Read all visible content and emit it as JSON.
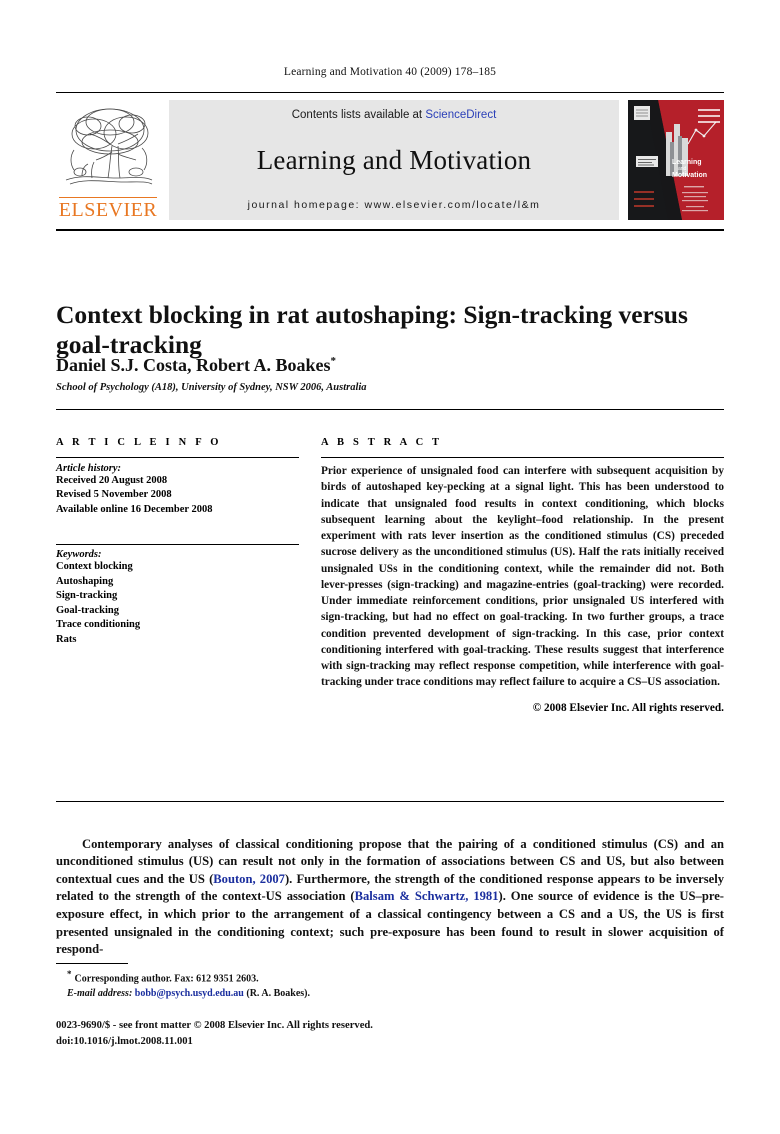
{
  "running_head": "Learning and Motivation 40 (2009) 178–185",
  "masthead": {
    "publisher_word": "ELSEVIER",
    "publisher_logo_name": "elsevier-tree-logo",
    "contents_prefix": "Contents lists available at ",
    "contents_link": "ScienceDirect",
    "journal_name": "Learning and Motivation",
    "homepage": "journal homepage: www.elsevier.com/locate/l&m",
    "cover_title_line1": "Learning",
    "cover_title_line2": "and",
    "cover_title_line3": "Motivation",
    "link_color": "#2b40b8",
    "elsevier_orange": "#E87722",
    "band_background": "#e6e6e6"
  },
  "article": {
    "title": "Context blocking in rat autoshaping: Sign-tracking versus goal-tracking",
    "authors": "Daniel S.J. Costa, Robert A. Boakes",
    "corresponding_marker": "*",
    "affiliation": "School of Psychology (A18), University of Sydney, NSW 2006, Australia"
  },
  "article_info": {
    "heading": "A R T I C L E   I N F O",
    "history_label": "Article history:",
    "history": [
      "Received 20 August 2008",
      "Revised 5 November 2008",
      "Available online 16 December 2008"
    ],
    "keywords_label": "Keywords:",
    "keywords": [
      "Context blocking",
      "Autoshaping",
      "Sign-tracking",
      "Goal-tracking",
      "Trace conditioning",
      "Rats"
    ]
  },
  "abstract": {
    "heading": "A B S T R A C T",
    "text": "Prior experience of unsignaled food can interfere with subsequent acquisition by birds of autoshaped key-pecking at a signal light. This has been understood to indicate that unsignaled food results in context conditioning, which blocks subsequent learning about the keylight–food relationship. In the present experiment with rats lever insertion as the conditioned stimulus (CS) preceded sucrose delivery as the unconditioned stimulus (US). Half the rats initially received unsignaled USs in the conditioning context, while the remainder did not. Both lever-presses (sign-tracking) and magazine-entries (goal-tracking) were recorded. Under immediate reinforcement conditions, prior unsignaled US interfered with sign-tracking, but had no effect on goal-tracking. In two further groups, a trace condition prevented development of sign-tracking. In this case, prior context conditioning interfered with goal-tracking. These results suggest that interference with sign-tracking may reflect response competition, while interference with goal-tracking under trace conditions may reflect failure to acquire a CS–US association.",
    "copyright": "© 2008 Elsevier Inc. All rights reserved."
  },
  "body": {
    "part1": "Contemporary analyses of classical conditioning propose that the pairing of a conditioned stimulus (CS) and an unconditioned stimulus (US) can result not only in the formation of associations between CS and US, but also between contextual cues and the US (",
    "cite1": "Bouton, 2007",
    "part2": "). Furthermore, the strength of the conditioned response appears to be inversely related to the strength of the context-US association (",
    "cite2": "Balsam & Schwartz, 1981",
    "part3": "). One source of evidence is the US–pre-exposure effect, in which prior to the arrangement of a classical contingency between a CS and a US, the US is first presented unsignaled in the conditioning context; such pre-exposure has been found to result in slower acquisition of respond-"
  },
  "footnote": {
    "corresponding": "Corresponding author. Fax: 612 9351 2603.",
    "email_label": "E-mail address:",
    "email": "bobb@psych.usyd.edu.au",
    "email_owner": "(R. A. Boakes).",
    "marker": "*"
  },
  "colophon": {
    "issn_line": "0023-9690/$ - see front matter © 2008 Elsevier Inc. All rights reserved.",
    "doi_line": "doi:10.1016/j.lmot.2008.11.001"
  }
}
